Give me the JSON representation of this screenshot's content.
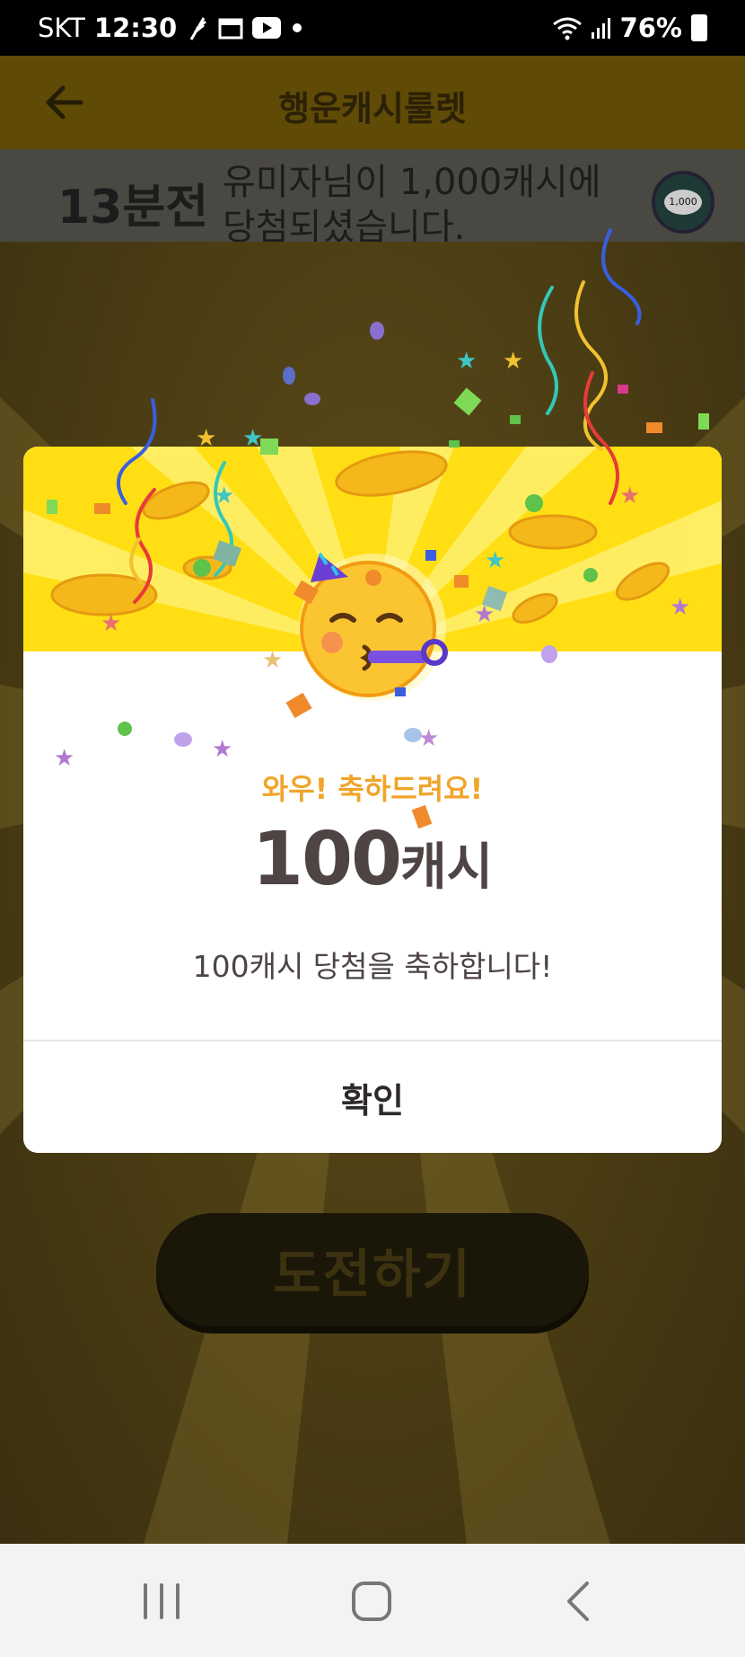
{
  "status_bar": {
    "carrier": "SKT",
    "time": "12:30",
    "battery": "76%",
    "icons": [
      "feather-icon",
      "calendar-icon",
      "youtube-icon",
      "dot-icon",
      "wifi-icon",
      "signal-icon",
      "battery-icon"
    ]
  },
  "header": {
    "title": "행운캐시룰렛",
    "back_icon": "arrow-left-icon"
  },
  "ticker": {
    "time_ago": "13분전",
    "message": "유미자님이 1,000캐시에 당첨되셨습니다.",
    "chip_label": "1,000"
  },
  "dialog": {
    "headline": "와우! 축하드려요!",
    "prize_amount": "100",
    "prize_unit": "캐시",
    "message": "100캐시 당첨을 축하합니다!",
    "confirm_label": "확인"
  },
  "challenge_button": {
    "label": "도전하기"
  },
  "nav": {
    "icons": [
      "recent-apps-icon",
      "home-icon",
      "back-icon"
    ]
  },
  "colors": {
    "accent_yellow": "#ffdf14",
    "headline_orange": "#f0a52a",
    "text_dark": "#4e4444"
  }
}
